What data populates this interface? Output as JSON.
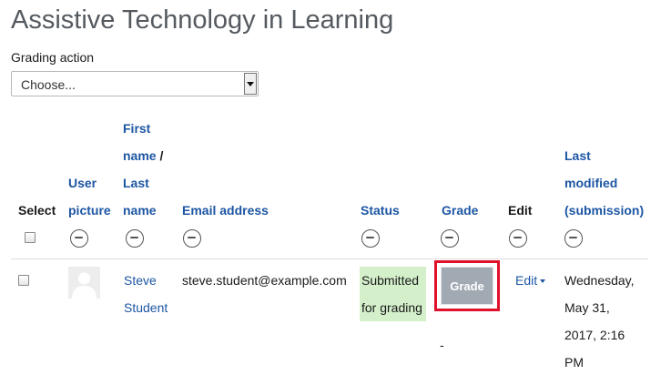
{
  "page": {
    "title": "Assistive Technology in Learning"
  },
  "grading_action": {
    "label": "Grading action",
    "selected": "Choose..."
  },
  "table": {
    "headers": {
      "select": "Select",
      "user_picture": [
        "User",
        "picture"
      ],
      "name_first": "First",
      "name_line2_link": "name",
      "name_sep": " /",
      "name_last": [
        "Last",
        "name"
      ],
      "email": "Email address",
      "status": "Status",
      "grade": "Grade",
      "edit": "Edit",
      "last_modified": [
        "Last",
        "modified",
        "(submission)"
      ]
    },
    "row": {
      "first_name": "Steve",
      "last_name": "Student",
      "email": "steve.student@example.com",
      "status": [
        "Submitted",
        "for grading"
      ],
      "grade_button": "Grade",
      "grade_value": "-",
      "edit_label": "Edit",
      "last_modified": [
        "Wednesday,",
        "May 31,",
        "2017, 2:16",
        "PM"
      ]
    }
  },
  "colors": {
    "link": "#1c56a3",
    "status_bg": "#d4f0cb",
    "highlight": "#e0112b",
    "grade_button": "#a1aab3"
  }
}
